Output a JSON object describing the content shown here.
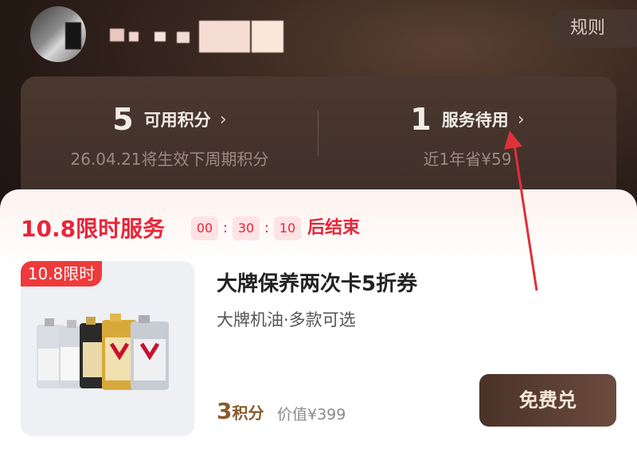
{
  "header": {
    "rules_label": "规则"
  },
  "stats": {
    "points_value": "5",
    "points_label": "可用积分",
    "points_sub": "26.04.21将生效下周期积分",
    "service_value": "1",
    "service_label": "服务待用",
    "service_sub": "近1年省¥59"
  },
  "flash_sale": {
    "title": "10.8限时服务",
    "countdown": [
      "00",
      "30",
      "10"
    ],
    "end_label": "后结束"
  },
  "product": {
    "tag": "10.8限时",
    "title": "大牌保养两次卡5折券",
    "subtitle": "大牌机油·多款可选",
    "points_number": "3",
    "points_unit": "积分",
    "price": "价值¥399",
    "redeem_label": "免费兑"
  },
  "colors": {
    "accent_red": "#e8263a",
    "brand_brown": "#4a3228",
    "annotation_arrow": "#e0303a"
  }
}
